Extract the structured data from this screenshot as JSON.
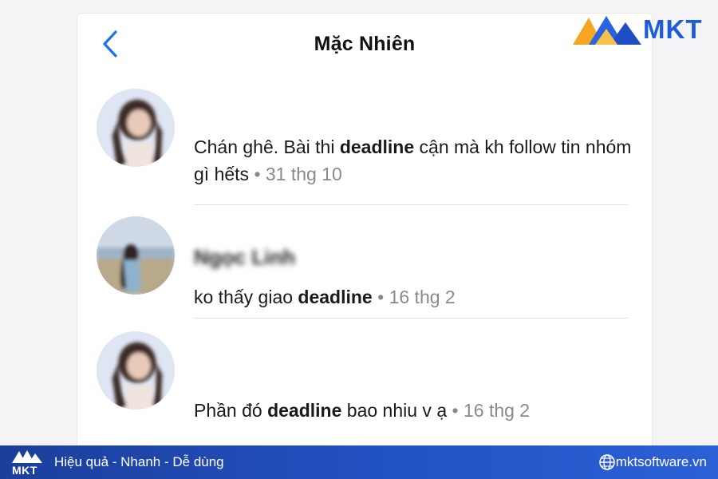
{
  "header": {
    "title": "Mặc Nhiên"
  },
  "brand": {
    "logo_text": "MKT"
  },
  "messages": [
    {
      "name": "",
      "text_parts": [
        "Chán ghê. Bài thi ",
        "deadline",
        " cận mà kh follow tin nhóm gì hếts"
      ],
      "date": "31 thg 10"
    },
    {
      "name": "Ngọc Linh",
      "text_parts": [
        "ko thấy giao ",
        "deadline",
        ""
      ],
      "date": "16 thg 2"
    },
    {
      "name": "",
      "text_parts": [
        "Phần đó ",
        "deadline",
        " bao nhiu v ạ"
      ],
      "date": "16 thg 2"
    }
  ],
  "footer": {
    "logo_text": "MKT",
    "slogan": "Hiệu quả - Nhanh - Dễ dùng",
    "website": "mktsoftware.vn"
  },
  "colors": {
    "back_chevron": "#1a73e8",
    "footer_start": "#1b3f9b",
    "footer_end": "#2b60d6",
    "logo_blue": "#1e5bd8",
    "logo_orange": "#f6a623"
  },
  "icons": [
    "back-chevron-icon",
    "globe-icon",
    "mkt-logo-icon"
  ]
}
